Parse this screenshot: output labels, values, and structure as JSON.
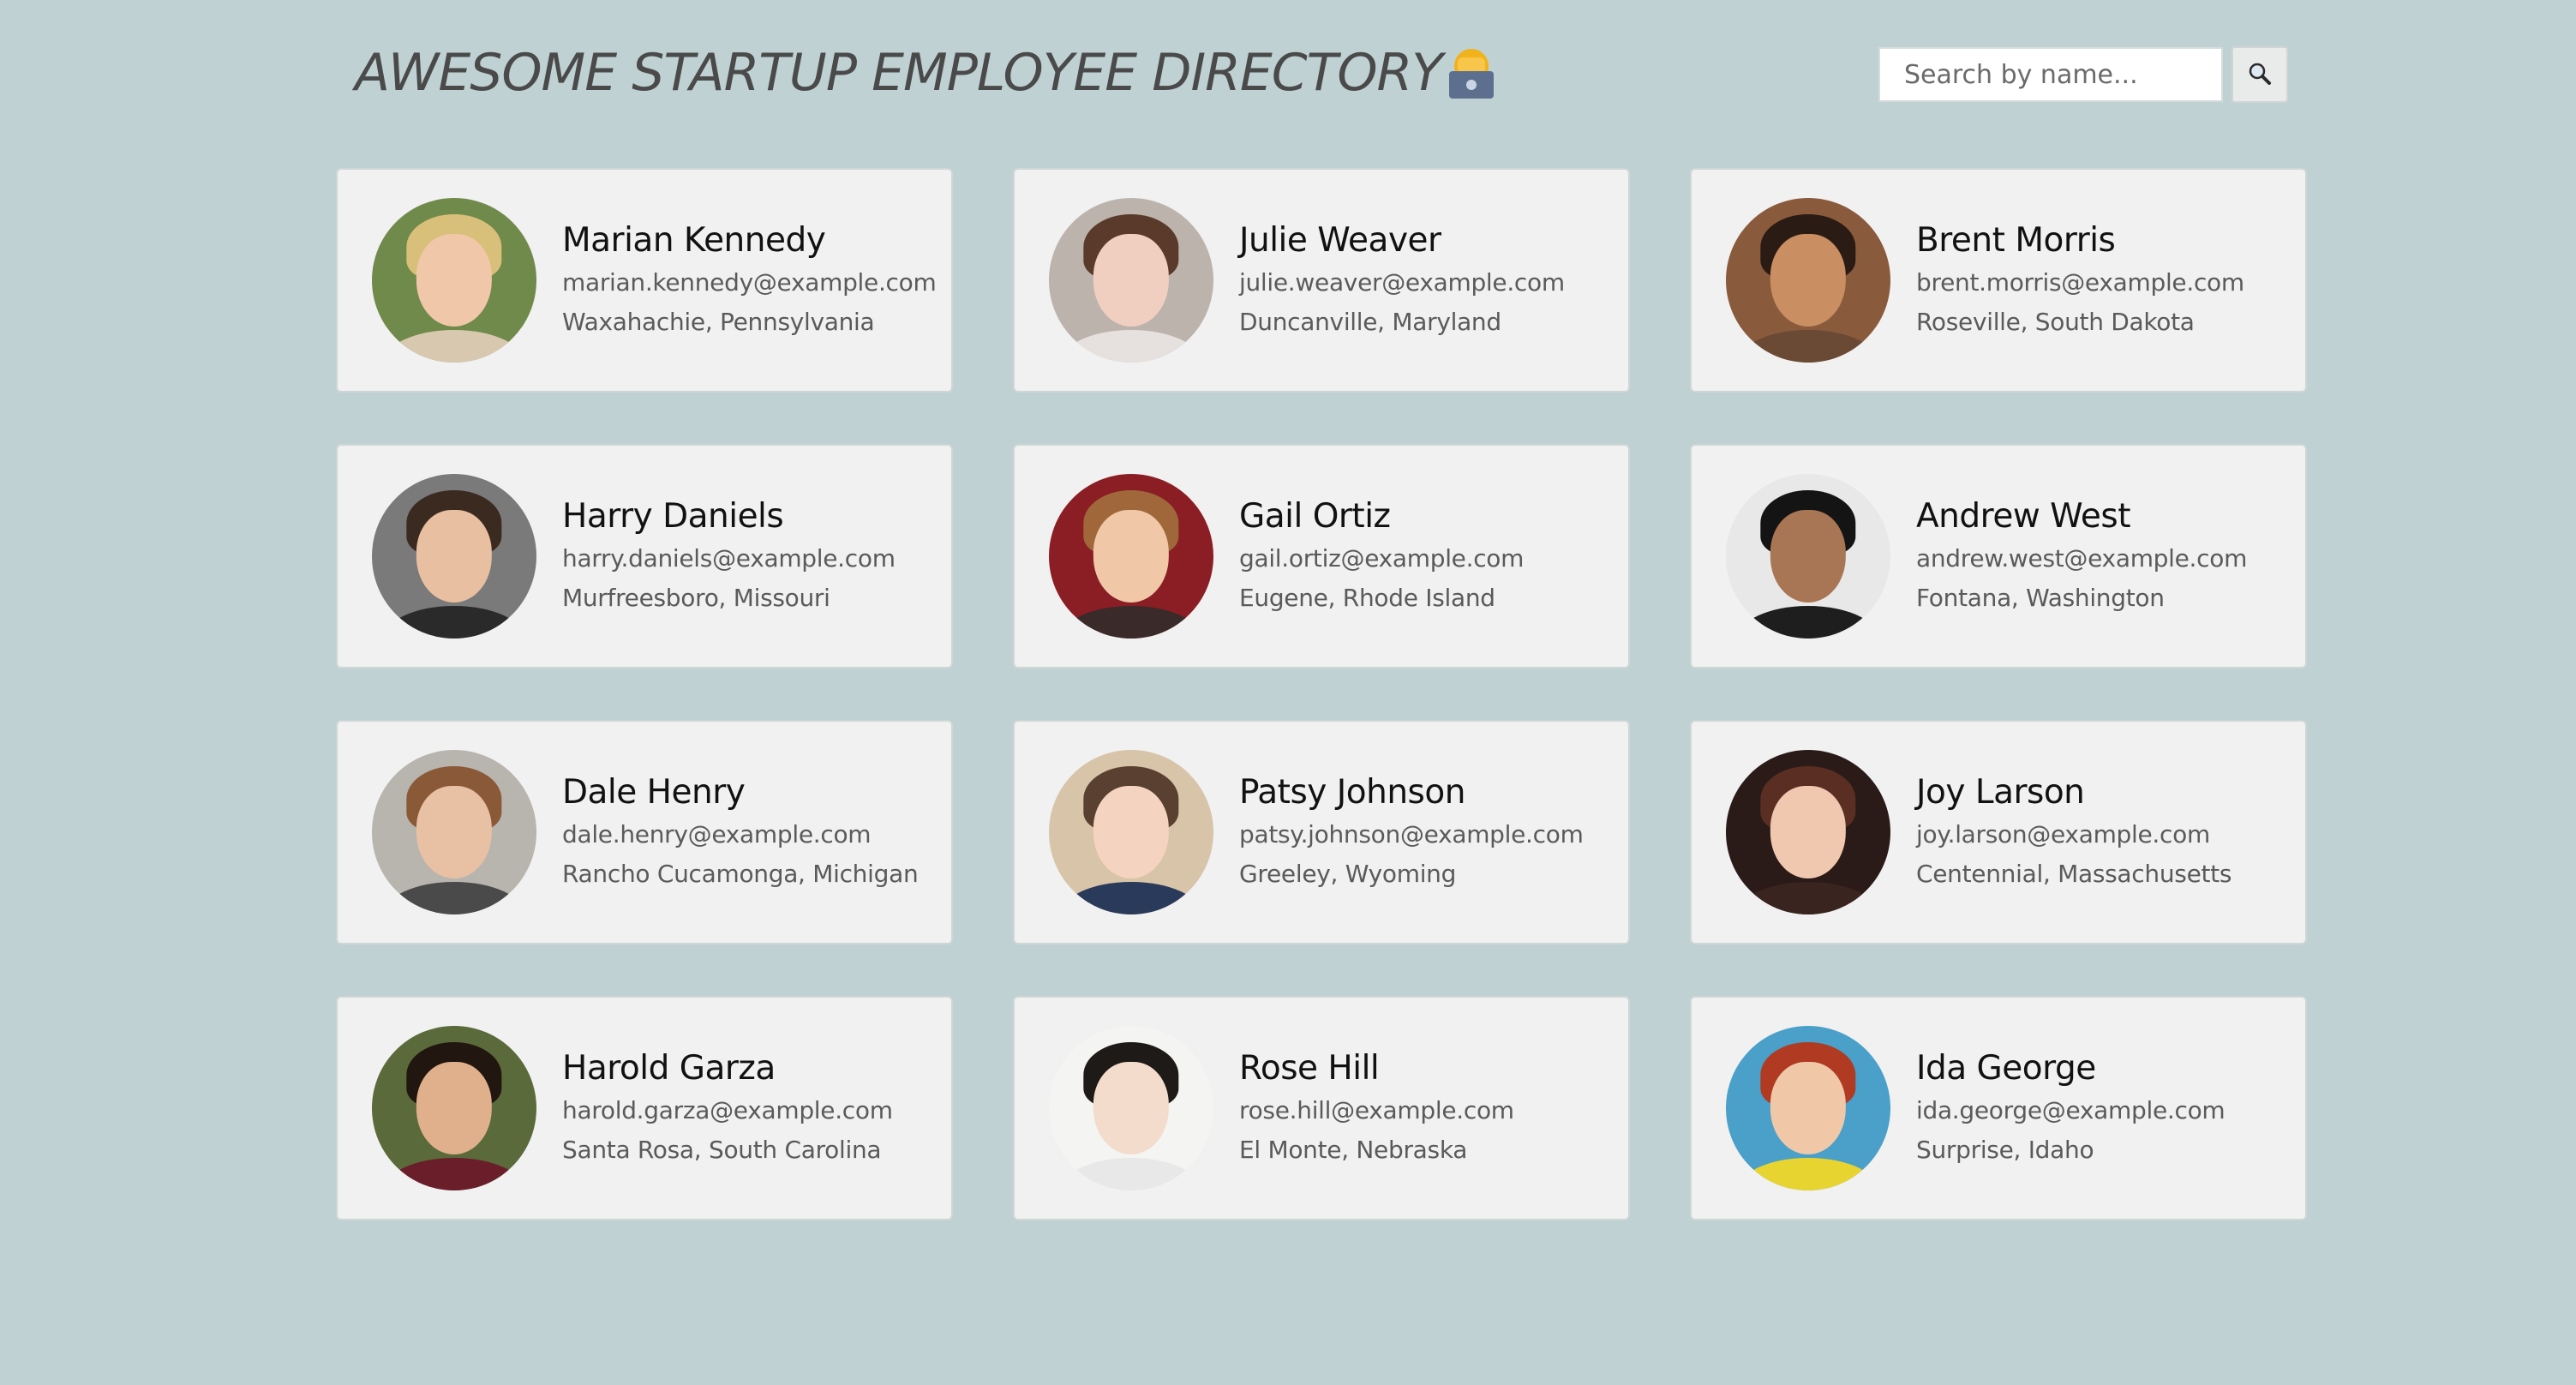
{
  "header": {
    "title": "AWESOME STARTUP EMPLOYEE DIRECTORY",
    "title_emoji_icon": "technologist-emoji-icon"
  },
  "search": {
    "placeholder": "Search by name...",
    "value": "",
    "button_icon": "magnifier-icon"
  },
  "employees": [
    {
      "name": "Marian Kennedy",
      "email": "marian.kennedy@example.com",
      "location": "Waxahachie, Pennsylvania",
      "avatar_colors": {
        "bg": "#6f8a4a",
        "hair": "#d9c07a",
        "skin": "#f0c7a8",
        "shirt": "#d8c8b0"
      }
    },
    {
      "name": "Julie Weaver",
      "email": "julie.weaver@example.com",
      "location": "Duncanville, Maryland",
      "avatar_colors": {
        "bg": "#bdb3ad",
        "hair": "#5a3a2a",
        "skin": "#f1cfc0",
        "shirt": "#e6e0de"
      }
    },
    {
      "name": "Brent Morris",
      "email": "brent.morris@example.com",
      "location": "Roseville, South Dakota",
      "avatar_colors": {
        "bg": "#8a5a3c",
        "hair": "#2a1c14",
        "skin": "#c98e62",
        "shirt": "#6a4a34"
      }
    },
    {
      "name": "Harry Daniels",
      "email": "harry.daniels@example.com",
      "location": "Murfreesboro, Missouri",
      "avatar_colors": {
        "bg": "#7a7a7a",
        "hair": "#3a2a20",
        "skin": "#e8bfa0",
        "shirt": "#2a2a2a"
      }
    },
    {
      "name": "Gail Ortiz",
      "email": "gail.ortiz@example.com",
      "location": "Eugene, Rhode Island",
      "avatar_colors": {
        "bg": "#8a1e24",
        "hair": "#a0683a",
        "skin": "#f0c8a8",
        "shirt": "#3a2a2a"
      }
    },
    {
      "name": "Andrew West",
      "email": "andrew.west@example.com",
      "location": "Fontana, Washington",
      "avatar_colors": {
        "bg": "#e8e8e8",
        "hair": "#141414",
        "skin": "#a87654",
        "shirt": "#1e1e1e"
      }
    },
    {
      "name": "Dale Henry",
      "email": "dale.henry@example.com",
      "location": "Rancho Cucamonga, Michigan",
      "avatar_colors": {
        "bg": "#b8b4ae",
        "hair": "#8a5a38",
        "skin": "#e8c0a4",
        "shirt": "#4a4a4a"
      }
    },
    {
      "name": "Patsy Johnson",
      "email": "patsy.johnson@example.com",
      "location": "Greeley, Wyoming",
      "avatar_colors": {
        "bg": "#d8c4a8",
        "hair": "#5a4030",
        "skin": "#f4d4c0",
        "shirt": "#2a3a5a"
      }
    },
    {
      "name": "Joy Larson",
      "email": "joy.larson@example.com",
      "location": "Centennial, Massachusetts",
      "avatar_colors": {
        "bg": "#2a1a18",
        "hair": "#5a2e22",
        "skin": "#f0c8b0",
        "shirt": "#3a2420"
      }
    },
    {
      "name": "Harold Garza",
      "email": "harold.garza@example.com",
      "location": "Santa Rosa, South Carolina",
      "avatar_colors": {
        "bg": "#5a6a3a",
        "hair": "#221610",
        "skin": "#e0b08c",
        "shirt": "#6a1e2a"
      }
    },
    {
      "name": "Rose Hill",
      "email": "rose.hill@example.com",
      "location": "El Monte, Nebraska",
      "avatar_colors": {
        "bg": "#f4f4f2",
        "hair": "#1e1a18",
        "skin": "#f4dccc",
        "shirt": "#e8e8e8"
      }
    },
    {
      "name": "Ida George",
      "email": "ida.george@example.com",
      "location": "Surprise, Idaho",
      "avatar_colors": {
        "bg": "#4aa0c8",
        "hair": "#b03a22",
        "skin": "#f0c8a8",
        "shirt": "#e8d430"
      }
    }
  ],
  "colors": {
    "page_bg": "#bfd1d2",
    "card_bg": "#f1f1f1",
    "title_text": "#4a4a4a",
    "name_text": "#111111",
    "detail_text": "#5a5a5a"
  }
}
